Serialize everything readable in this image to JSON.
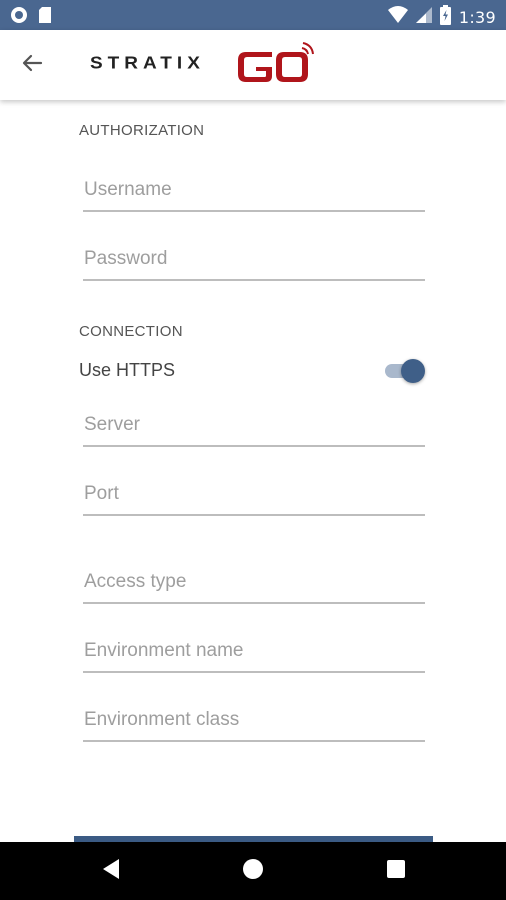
{
  "status_bar": {
    "time": "1:39",
    "icons": [
      "circle-notification-icon",
      "sd-card-icon",
      "wifi-icon",
      "signal-icon",
      "battery-charging-icon"
    ]
  },
  "app_bar": {
    "back_icon": "arrow-left-icon",
    "logo_text": "STRATIX",
    "logo_accent": "GO"
  },
  "authorization": {
    "title": "AUTHORIZATION",
    "username_placeholder": "Username",
    "password_placeholder": "Password"
  },
  "connection": {
    "title": "CONNECTION",
    "https_label": "Use HTTPS",
    "https_enabled": true,
    "server_placeholder": "Server",
    "port_placeholder": "Port",
    "access_type_placeholder": "Access type",
    "environment_name_placeholder": "Environment name",
    "environment_class_placeholder": "Environment class"
  },
  "nav_bar": {
    "icons": [
      "back-triangle-icon",
      "home-circle-icon",
      "recents-square-icon"
    ]
  },
  "colors": {
    "status_bar": "#4a6790",
    "accent": "#3f5f88",
    "logo_red": "#b0151b",
    "underline": "#bdbdbd"
  }
}
